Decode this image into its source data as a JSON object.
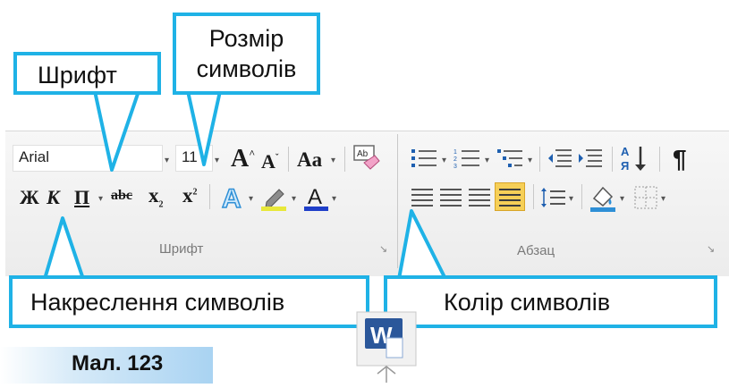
{
  "callouts": {
    "font": "Шрифт",
    "size_line1": "Розмір",
    "size_line2": "символів",
    "style": "Накреслення символів",
    "color": "Колір символів"
  },
  "ribbon": {
    "font_name": "Arial",
    "font_size": "11",
    "grow_font": "A",
    "shrink_font": "A",
    "change_case": "Aa",
    "bold": "Ж",
    "italic": "К",
    "underline": "П",
    "strikethrough": "abc",
    "subscript": "x",
    "superscript": "x",
    "subscript_index": "2",
    "superscript_index": "2",
    "font_color_letter": "A",
    "text_effects_letter": "A",
    "sort": "А↓",
    "pilcrow": "¶",
    "group_font": "Шрифт",
    "group_paragraph": "Абзац"
  },
  "caption": "Мал. 123",
  "word_icon_letter": "W",
  "colors": {
    "callout_border": "#1fb2e6",
    "font_color_bar": "#1f3fc9",
    "highlight_bar": "#e8e83a",
    "word_blue": "#2b579a"
  }
}
